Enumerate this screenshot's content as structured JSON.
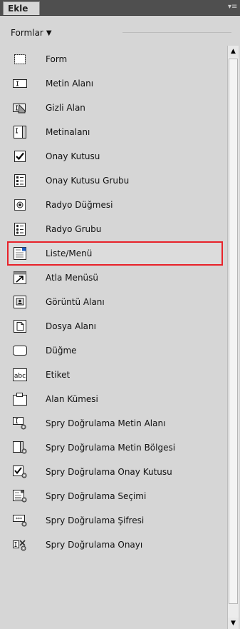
{
  "panel": {
    "tab_label": "Ekle",
    "menu_icon": "panel-menu-icon"
  },
  "category": {
    "label": "Formlar",
    "icon": "caret-down-icon"
  },
  "items": [
    {
      "label": "Form",
      "icon": "form-icon"
    },
    {
      "label": "Metin Alanı",
      "icon": "text-field-icon"
    },
    {
      "label": "Gizli Alan",
      "icon": "hidden-field-icon"
    },
    {
      "label": "Metinalanı",
      "icon": "textarea-icon"
    },
    {
      "label": "Onay Kutusu",
      "icon": "checkbox-icon"
    },
    {
      "label": "Onay Kutusu Grubu",
      "icon": "checkbox-group-icon"
    },
    {
      "label": "Radyo Düğmesi",
      "icon": "radio-button-icon"
    },
    {
      "label": "Radyo Grubu",
      "icon": "radio-group-icon"
    },
    {
      "label": "Liste/Menü",
      "icon": "list-menu-icon",
      "selected": true
    },
    {
      "label": "Atla Menüsü",
      "icon": "jump-menu-icon"
    },
    {
      "label": "Görüntü Alanı",
      "icon": "image-field-icon"
    },
    {
      "label": "Dosya Alanı",
      "icon": "file-field-icon"
    },
    {
      "label": "Düğme",
      "icon": "button-icon"
    },
    {
      "label": "Etiket",
      "icon": "label-icon"
    },
    {
      "label": "Alan Kümesi",
      "icon": "fieldset-icon"
    },
    {
      "label": "Spry Doğrulama Metin Alanı",
      "icon": "spry-text-field-icon"
    },
    {
      "label": "Spry Doğrulama Metin Bölgesi",
      "icon": "spry-textarea-icon"
    },
    {
      "label": "Spry Doğrulama Onay Kutusu",
      "icon": "spry-checkbox-icon"
    },
    {
      "label": "Spry Doğrulama Seçimi",
      "icon": "spry-select-icon"
    },
    {
      "label": "Spry Doğrulama Şifresi",
      "icon": "spry-password-icon"
    },
    {
      "label": "Spry Doğrulama Onayı",
      "icon": "spry-confirm-icon"
    }
  ],
  "colors": {
    "selection_border": "#e8222a",
    "panel_bg": "#d6d6d6",
    "tab_bar": "#4f4f4f"
  }
}
